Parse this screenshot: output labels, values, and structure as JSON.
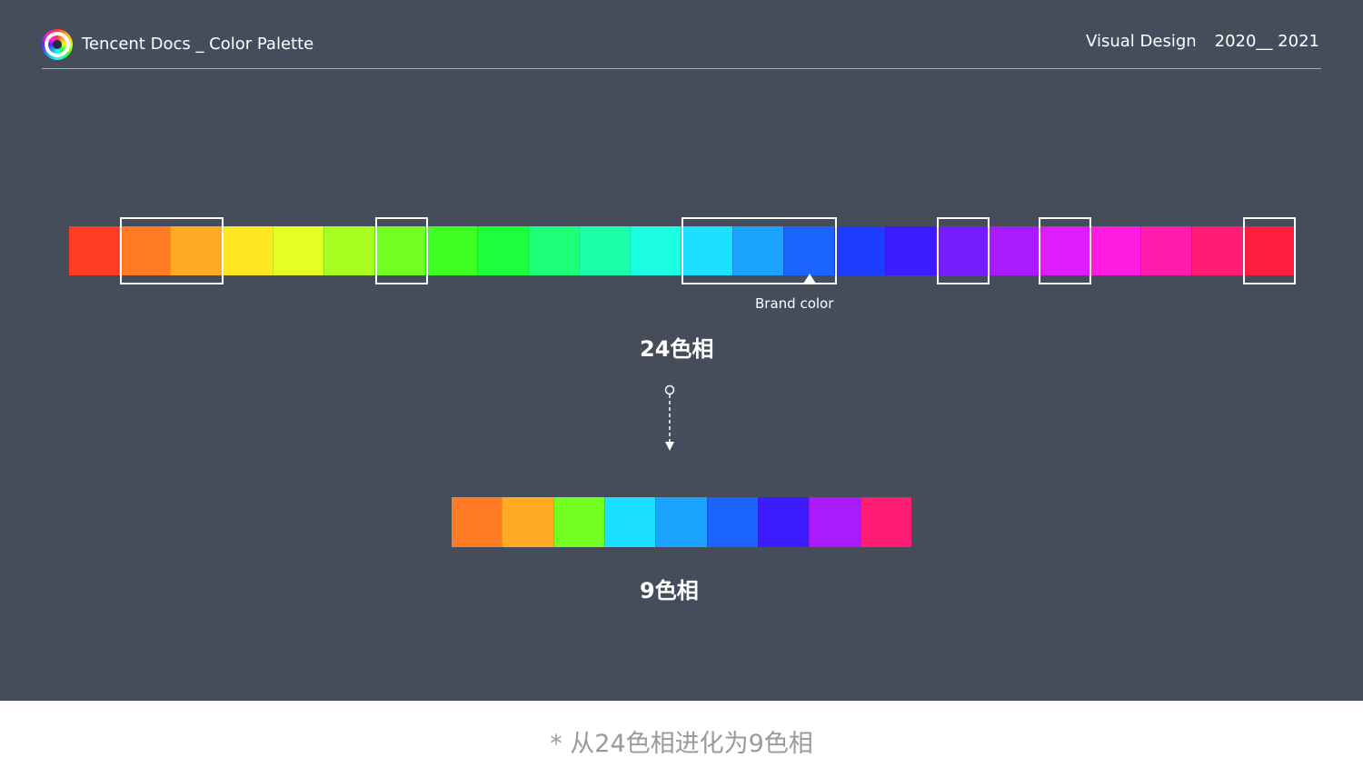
{
  "header": {
    "title": "Tencent Docs _ Color Palette",
    "right_label": "Visual Design",
    "years": "2020__ 2021",
    "logo_icon": "color-wheel-icon"
  },
  "palette24": {
    "label": "24色相",
    "brand_label": "Brand color",
    "swatches": [
      "#ff3b24",
      "#ff7a22",
      "#ffaa22",
      "#ffe622",
      "#e6ff22",
      "#aaff22",
      "#74ff22",
      "#40ff22",
      "#1cff3c",
      "#1cff76",
      "#1cffaa",
      "#1cffe0",
      "#1ce0ff",
      "#1ca2ff",
      "#1c64ff",
      "#1c3cff",
      "#3c1cff",
      "#761cff",
      "#aa1cff",
      "#e01cff",
      "#ff1ce0",
      "#ff1caa",
      "#ff1c72",
      "#ff1c3c"
    ],
    "brand_index": 14,
    "selected_groups": [
      [
        1,
        2
      ],
      [
        6
      ],
      [
        12,
        13,
        14
      ],
      [
        17
      ],
      [
        19
      ],
      [
        23
      ]
    ]
  },
  "palette9": {
    "label": "9色相",
    "swatches": [
      "#ff7a22",
      "#ffaa22",
      "#74ff22",
      "#1ce0ff",
      "#1ca2ff",
      "#1c64ff",
      "#3c1cff",
      "#aa1cff",
      "#ff1c72"
    ]
  },
  "caption": "* 从24色相进化为9色相",
  "colors": {
    "background": "#464d5a",
    "text": "#ffffff",
    "caption": "#9a9a9a"
  }
}
